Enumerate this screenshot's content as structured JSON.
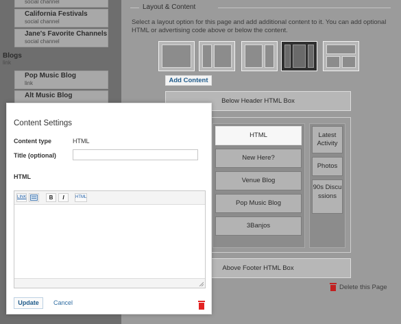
{
  "sidebar": {
    "items": [
      {
        "title": "",
        "sub": "social channel"
      },
      {
        "title": "California Festivals",
        "sub": "social channel"
      },
      {
        "title": "Jane's Favorite Channels",
        "sub": "social channel"
      },
      {
        "title": "Blogs",
        "sub": "link"
      },
      {
        "title": "Pop Music Blog",
        "sub": "link"
      },
      {
        "title": "Alt Music Blog",
        "sub": ""
      }
    ]
  },
  "layout": {
    "legend": "Layout & Content",
    "description": "Select a layout option for this page and add additional content to it. You can add optional HTML or advertising code above or below the content.",
    "add_content_label": "Add Content",
    "below_header_label": "Below Header HTML Box",
    "above_footer_label": "Above Footer HTML Box",
    "main_modules": [
      "HTML",
      "New Here?",
      "Venue Blog",
      "Pop Music Blog",
      "3Banjos"
    ],
    "side_modules": [
      "Latest Activity",
      "Photos",
      "90s Discussions"
    ],
    "delete_page_label": "Delete this Page",
    "selected_layout_index": 3
  },
  "modal": {
    "title": "Content Settings",
    "content_type_label": "Content type",
    "content_type_value": "HTML",
    "title_label": "Title (optional)",
    "title_value": "",
    "html_label": "HTML",
    "html_value": "",
    "toolbar": {
      "link": "LINK",
      "image": "",
      "bold": "B",
      "italic": "I",
      "html": "HTML"
    },
    "update_label": "Update",
    "cancel_label": "Cancel"
  },
  "colors": {
    "accent": "#1e5a8a",
    "danger": "#e32222"
  }
}
